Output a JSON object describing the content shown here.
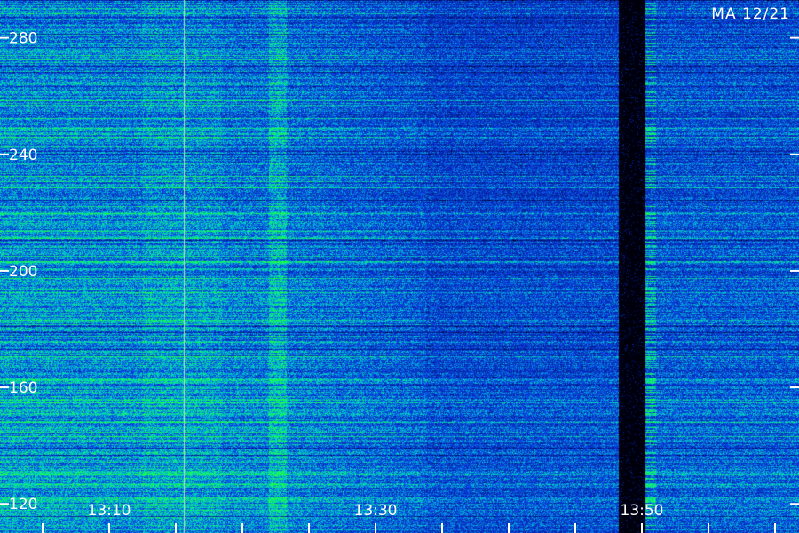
{
  "stamp": "MA 12/21",
  "colors": {
    "background": "#000010",
    "low": "#000a50",
    "mid": "#0a3ce6",
    "high": "#00d2c8",
    "peak": "#1eff3c",
    "text": "#ffffff"
  },
  "chart_data": {
    "type": "heatmap",
    "title": "",
    "xlabel": "",
    "ylabel": "",
    "x_ticks": [
      "13:10",
      "13:30",
      "13:50"
    ],
    "x_tick_minutes": [
      10,
      30,
      50
    ],
    "x_range_minutes": [
      1.8,
      61.8
    ],
    "x_minor_tick_step_minutes": 5,
    "y_ticks": [
      280,
      240,
      200,
      160,
      120
    ],
    "ylim": [
      110,
      293
    ],
    "colormap": [
      "#000a50",
      "#0a3ce6",
      "#00d2c8",
      "#1eff3c"
    ],
    "features": [
      {
        "name": "signal-gap",
        "x_start_minutes": 48.2,
        "x_end_minutes": 50.2
      },
      {
        "name": "vertical-line",
        "x_minutes": 15.6
      },
      {
        "name": "bright-band",
        "x_start_minutes": 22.0,
        "x_end_minutes": 23.3
      }
    ]
  }
}
